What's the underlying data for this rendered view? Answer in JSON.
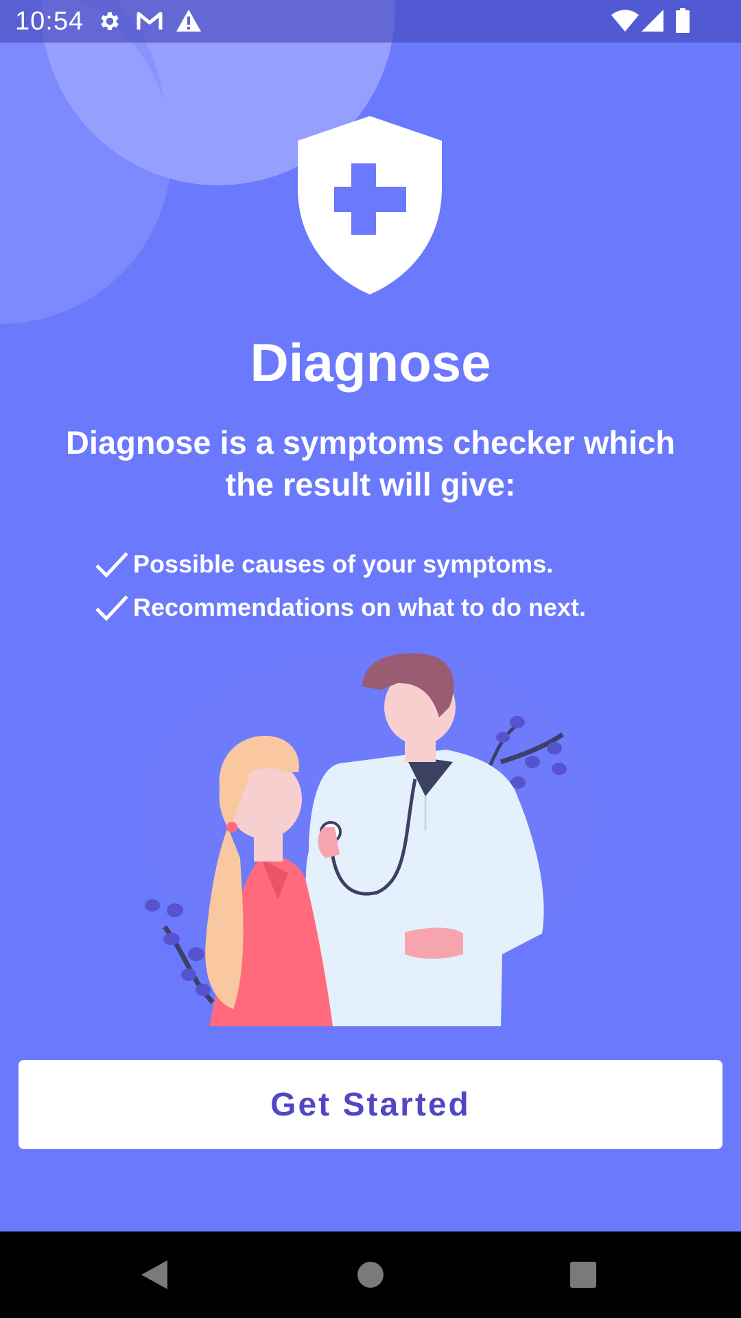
{
  "status_bar": {
    "time": "10:54",
    "icons": [
      "gear-icon",
      "gmail-icon",
      "alert-icon",
      "wifi-icon",
      "signal-icon",
      "battery-icon"
    ]
  },
  "app": {
    "logo_icon": "shield-plus-icon",
    "title": "Diagnose",
    "subtitle": "Diagnose is a symptoms checker which the result will give:",
    "features": [
      {
        "icon": "check-icon",
        "text": "Possible causes of your symptoms."
      },
      {
        "icon": "check-icon",
        "text": "Recommendations on what to do next."
      }
    ],
    "illustration": "doctor-patient-illustration",
    "button_label": "Get Started"
  },
  "nav_bar": {
    "icons": [
      "back-icon",
      "home-icon",
      "recents-icon"
    ]
  },
  "colors": {
    "background": "#6b79fd",
    "status_bar": "#5a5fd1",
    "button_text": "#5147c5",
    "button_bg": "#ffffff",
    "nav_bar": "#000000"
  }
}
